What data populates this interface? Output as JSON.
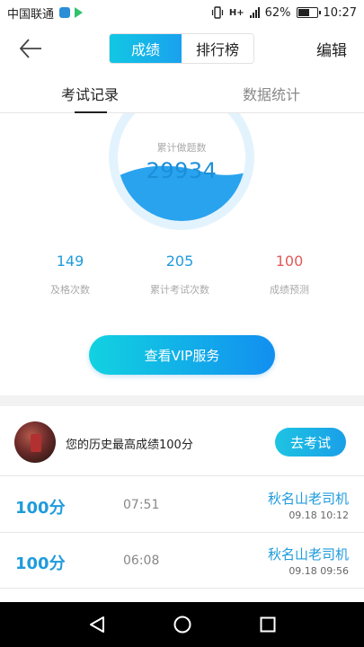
{
  "status_bar": {
    "carrier": "中国联通",
    "network": "H+",
    "battery": "62%",
    "battery_level": 0.62,
    "time": "10:27"
  },
  "header": {
    "segments": [
      "成绩",
      "排行榜"
    ],
    "active_segment": 0,
    "edit_label": "编辑"
  },
  "tabs": [
    "考试记录",
    "数据统计"
  ],
  "stats": {
    "ring_label": "累计做题数",
    "ring_value": "29934",
    "metrics": [
      {
        "value": "149",
        "label": "及格次数",
        "color": "#1f9bdc"
      },
      {
        "value": "205",
        "label": "累计考试次数",
        "color": "#1f9bdc"
      },
      {
        "value": "100",
        "label": "成绩预测",
        "color": "#e05a5a"
      }
    ],
    "vip_button": "查看VIP服务"
  },
  "best": {
    "text": "您的历史最高成绩100分",
    "button": "去考试"
  },
  "records": [
    {
      "score": "100分",
      "duration": "07:51",
      "name": "秋名山老司机",
      "date": "09.18  10:12"
    },
    {
      "score": "100分",
      "duration": "06:08",
      "name": "秋名山老司机",
      "date": "09.18  09:56"
    }
  ],
  "colors": {
    "accent": "#1aa1ee",
    "accent_light": "#12c7e3",
    "score_blue": "#1f9bdc",
    "prediction_red": "#e05a5a"
  }
}
